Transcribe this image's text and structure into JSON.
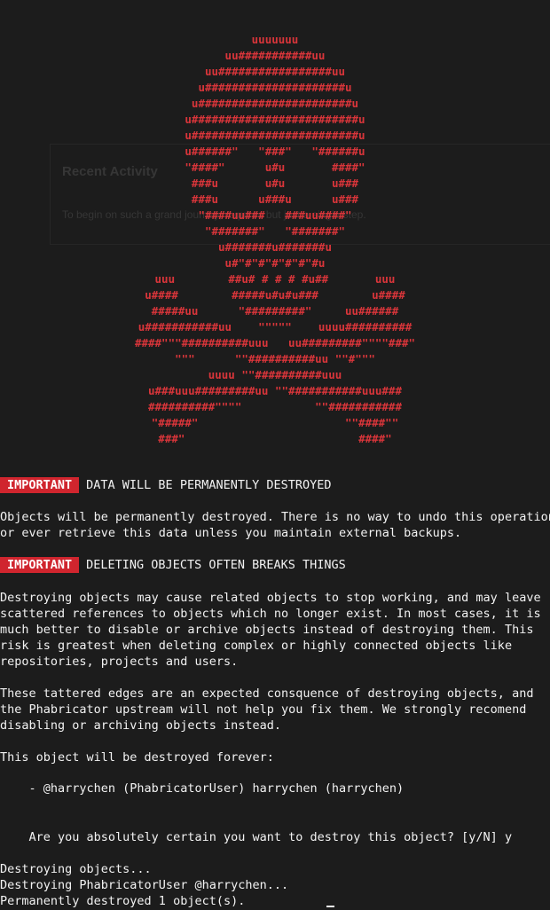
{
  "background_panel": {
    "title": "Recent Activity",
    "text": "To begin on such a grand journey, requires but just a single step."
  },
  "skull_art": [
    "uuuuuuu",
    "uu###########uu",
    "uu#################uu",
    "u#####################u",
    "u#######################u",
    "u#########################u",
    "u#########################u",
    "u######\"   \"###\"   \"######u",
    "\"####\"      u#u       ####\"",
    "###u       u#u       u###",
    "###u      u###u      u###",
    "\"####uu###   ###uu####\"",
    "\"#######\"   \"#######\"",
    "u#######u#######u",
    "u#\"#\"#\"#\"#\"#\"#u",
    "uuu        ##u# # # # #u##       uuu",
    "u####        #####u#u#u###        u####",
    "#####uu      \"#########\"     uu######",
    "u###########uu    \"\"\"\"\"    uuuu##########",
    "####\"\"\"##########uuu   uu#########\"\"\"\"###\"",
    "\"\"\"      \"\"##########uu \"\"#\"\"\"",
    "uuuu \"\"##########uuu",
    "u###uuu#########uu \"\"###########uuu###",
    "##########\"\"\"\"           \"\"###########",
    "\"#####\"                      \"\"####\"\"",
    "###\"                          ####\""
  ],
  "warnings": [
    {
      "badge": "IMPORTANT",
      "heading": "DATA WILL BE PERMANENTLY DESTROYED"
    },
    {
      "badge": "IMPORTANT",
      "heading": "DELETING OBJECTS OFTEN BREAKS THINGS"
    }
  ],
  "text_blocks": {
    "data_destroyed": "Objects will be permanently destroyed. There is no way to undo this operation\nor ever retrieve this data unless you maintain external backups.",
    "breaks_things_1": "Destroying objects may cause related objects to stop working, and may leave\nscattered references to objects which no longer exist. In most cases, it is\nmuch better to disable or archive objects instead of destroying them. This\nrisk is greatest when deleting complex or highly connected objects like\nrepositories, projects and users.",
    "breaks_things_2": "These tattered edges are an expected consquence of destroying objects, and\nthe Phabricator upstream will not help you fix them. We strongly recomend\ndisabling or archiving objects instead.",
    "destroy_forever": "This object will be destroyed forever:",
    "object_item": "    - @harrychen (PhabricatorUser) harrychen (harrychen)",
    "prompt": "    Are you absolutely certain you want to destroy this object? [y/N] y",
    "result": "Destroying objects...\nDestroying PhabricatorUser @harrychen...\nPermanently destroyed 1 object(s)."
  }
}
